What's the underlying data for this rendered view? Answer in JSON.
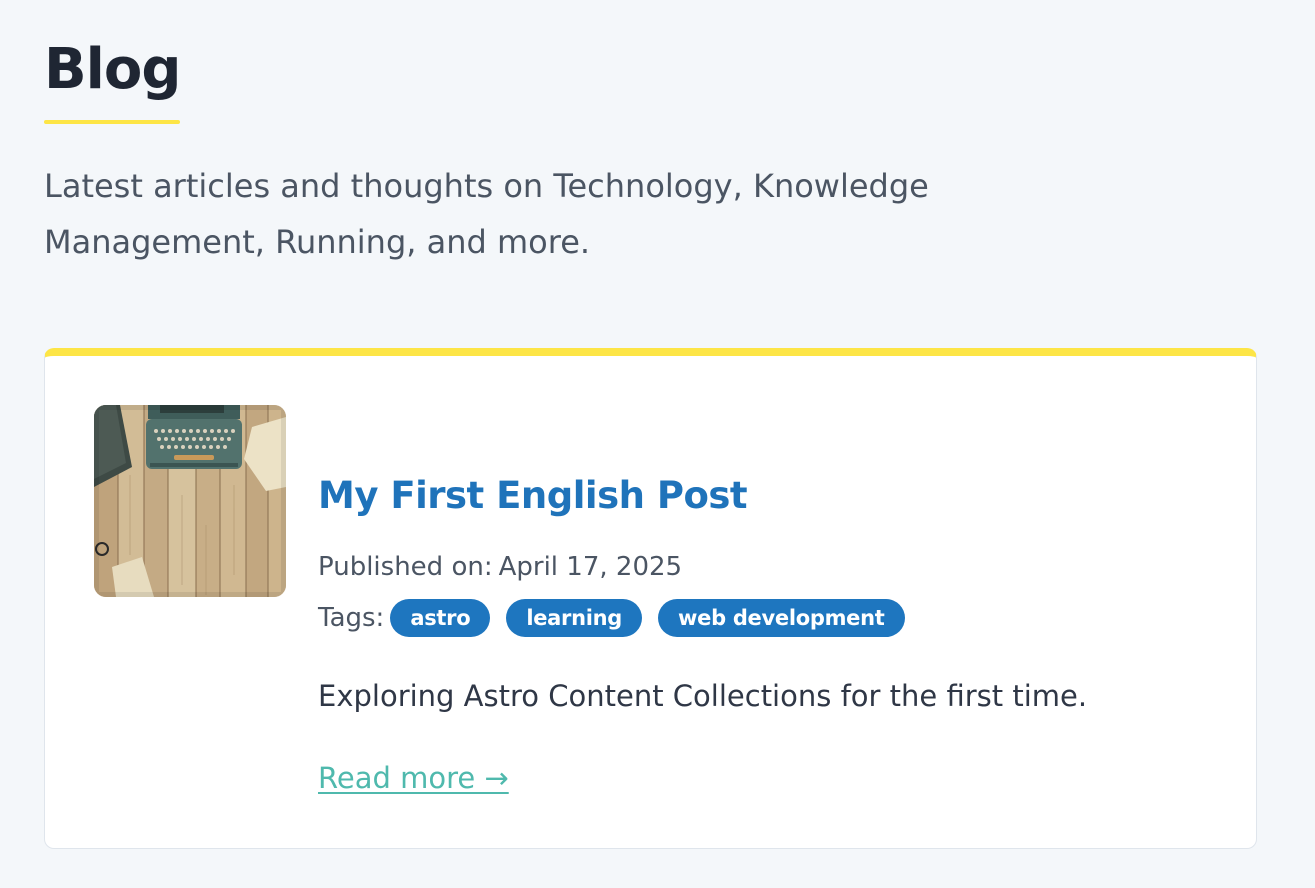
{
  "page": {
    "title": "Blog",
    "intro": "Latest articles and thoughts on Technology, Knowledge Management, Running, and more."
  },
  "posts": [
    {
      "title": "My First English Post",
      "date_label": "Published on:",
      "date": "April 17, 2025",
      "tags_label": "Tags:",
      "tags": [
        "astro",
        "learning",
        "web development"
      ],
      "description": "Exploring Astro Content Collections for the first time.",
      "read_more": "Read more →",
      "thumbnail": "typewriter-on-wooden-desk"
    }
  ],
  "colors": {
    "background": "#f4f7fa",
    "accent_yellow": "#fde546",
    "title_blue": "#1f73ba",
    "tag_blue": "#1e76bf",
    "link_teal": "#4fb9ad",
    "heading_dark": "#1f2633"
  }
}
